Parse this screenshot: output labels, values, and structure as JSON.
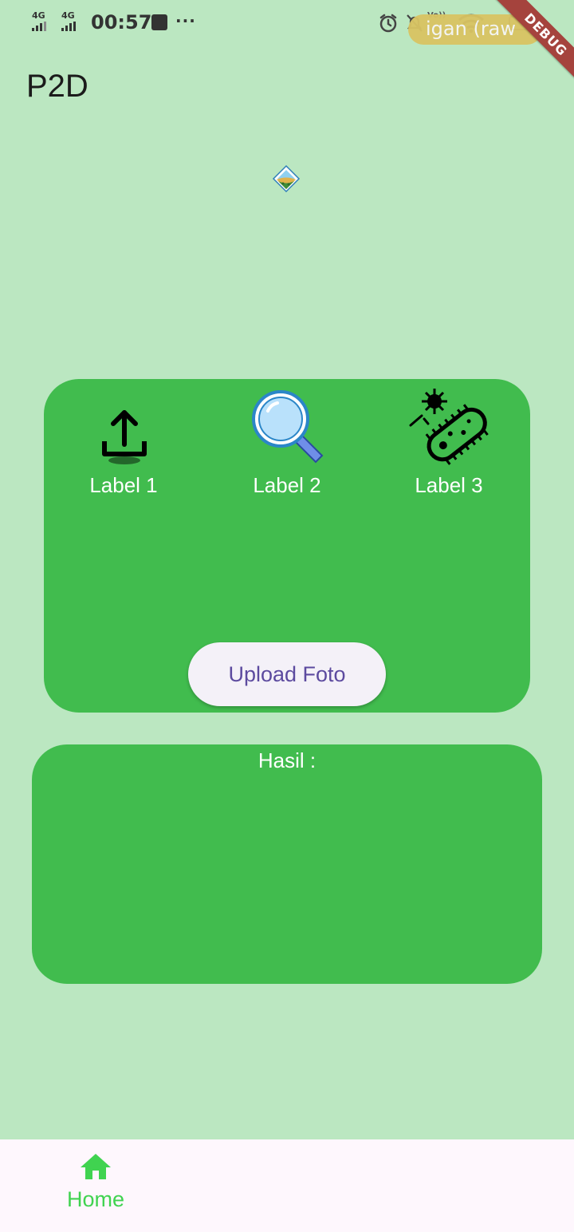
{
  "status_bar": {
    "network_1": "4G",
    "network_2": "4G",
    "time": "00:57",
    "more": "···",
    "volte": "Vo))",
    "pill_text": "igan (raw",
    "debug_banner": "DEBUG"
  },
  "app_bar": {
    "title": "P2D"
  },
  "label_card": {
    "items": [
      {
        "label": "Label 1",
        "icon": "upload-icon"
      },
      {
        "label": "Label 2",
        "icon": "magnifier-icon"
      },
      {
        "label": "Label 3",
        "icon": "bacteria-icon"
      }
    ],
    "upload_button": "Upload Foto"
  },
  "result_card": {
    "title": "Hasil :"
  },
  "bottom_nav": {
    "items": [
      {
        "label": "Home",
        "icon": "home-icon"
      }
    ]
  },
  "colors": {
    "background": "#bbe7c1",
    "card": "#41bc4e",
    "nav_active": "#40d350",
    "button_text": "#5c4a9f"
  }
}
